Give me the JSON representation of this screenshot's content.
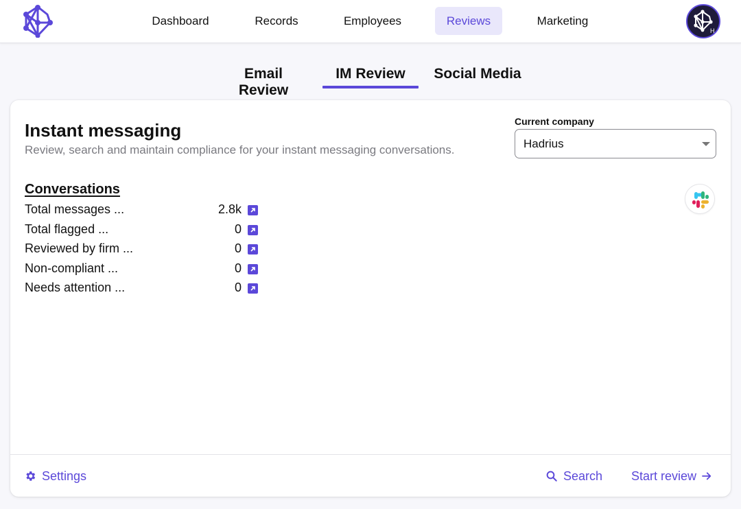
{
  "colors": {
    "accent": "#5b48d9",
    "accent_bg": "#e9e7fb",
    "page_bg": "#f7f7fb",
    "muted_text": "#7a7a80"
  },
  "topnav": {
    "logo_icon": "molecule-network-logo",
    "items": [
      {
        "label": "Dashboard",
        "active": false
      },
      {
        "label": "Records",
        "active": false
      },
      {
        "label": "Employees",
        "active": false
      },
      {
        "label": "Reviews",
        "active": true
      },
      {
        "label": "Marketing",
        "active": false
      }
    ],
    "avatar": {
      "icon": "molecule-network-logo",
      "badge": "H"
    }
  },
  "subtabs": [
    {
      "label": "Email Review",
      "active": false
    },
    {
      "label": "IM Review",
      "active": true
    },
    {
      "label": "Social Media",
      "active": false
    }
  ],
  "card": {
    "title": "Instant messaging",
    "subtitle": "Review, search and maintain compliance for your instant messaging conversations.",
    "company": {
      "label": "Current company",
      "selected": "Hadrius"
    },
    "section_title": "Conversations",
    "integration_icon": "slack-icon",
    "stats": [
      {
        "label": "Total messages ...",
        "value": "2.8k"
      },
      {
        "label": "Total flagged ...",
        "value": "0"
      },
      {
        "label": "Reviewed by firm ...",
        "value": "0"
      },
      {
        "label": "Non-compliant ...",
        "value": "0"
      },
      {
        "label": "Needs attention ...",
        "value": "0"
      }
    ],
    "footer": {
      "settings_label": "Settings",
      "search_label": "Search",
      "start_review_label": "Start review"
    }
  }
}
